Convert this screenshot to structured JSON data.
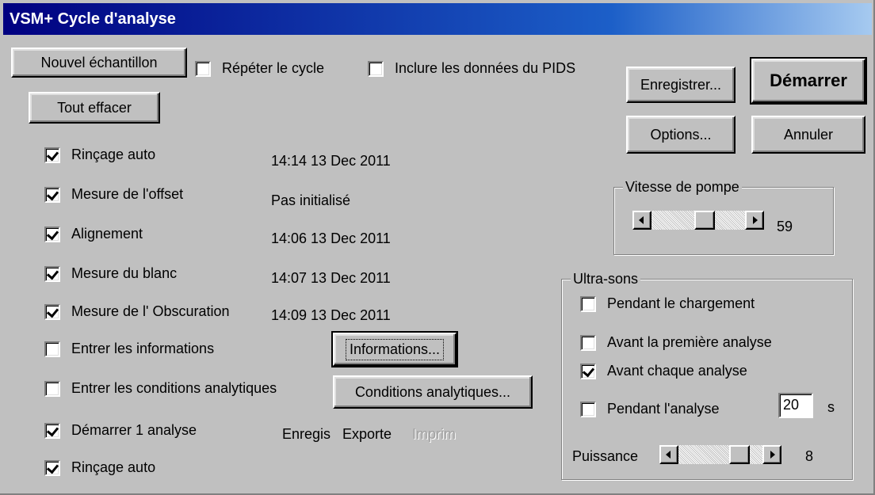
{
  "window": {
    "title": "VSM+ Cycle d'analyse"
  },
  "top": {
    "nouvel_echantillon": "Nouvel échantillon",
    "tout_effacer": "Tout effacer",
    "repeter_cycle": "Répéter le cycle",
    "inclure_pids": "Inclure les données du PIDS"
  },
  "buttons": {
    "enregistrer": "Enregistrer...",
    "demarrer": "Démarrer",
    "options": "Options...",
    "annuler": "Annuler",
    "informations": "Informations...",
    "conditions": "Conditions analytiques..."
  },
  "steps": [
    {
      "label": "Rinçage auto",
      "checked": true,
      "status": "14:14  13 Dec 2011"
    },
    {
      "label": "Mesure de l'offset",
      "checked": true,
      "status": "Pas initialisé"
    },
    {
      "label": "Alignement",
      "checked": true,
      "status": "14:06  13 Dec 2011"
    },
    {
      "label": "Mesure du blanc",
      "checked": true,
      "status": "14:07  13 Dec 2011"
    },
    {
      "label": "Mesure de l' Obscuration",
      "checked": true,
      "status": "14:09  13 Dec 2011"
    },
    {
      "label": "Entrer les informations",
      "checked": false
    },
    {
      "label": "Entrer les conditions analytiques",
      "checked": false
    },
    {
      "label": "Démarrer 1 analyse",
      "checked": true
    },
    {
      "label": "Rinçage auto",
      "checked": true
    }
  ],
  "analysis_outputs": {
    "enregistrer": "Enregis",
    "exporter": "Exporte",
    "imprimer": "Imprim"
  },
  "pump": {
    "group_title": "Vitesse de pompe",
    "value": "59",
    "level": 0.59
  },
  "ultrasons": {
    "group_title": "Ultra-sons",
    "pendant_chargement": "Pendant le chargement",
    "avant_premiere": "Avant la première analyse",
    "avant_chaque": "Avant chaque analyse",
    "pendant_analyse": "Pendant l'analyse",
    "duree": "20",
    "duree_unit": "s",
    "puissance_label": "Puissance",
    "puissance_value": "8",
    "puissance_level": 0.8
  }
}
